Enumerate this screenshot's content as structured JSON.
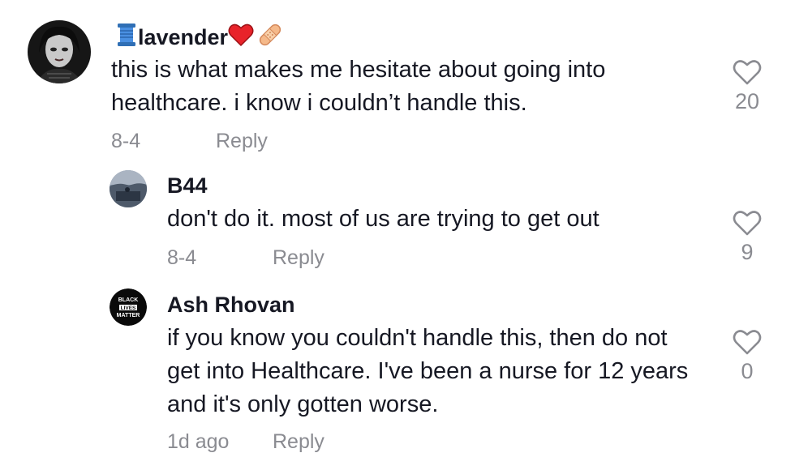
{
  "comments": [
    {
      "username": "lavender",
      "username_emojis": [
        "spool-icon",
        "heart-icon",
        "bandage-icon"
      ],
      "text": "this is what makes me hesitate about going into healthcare. i know i couldn’t handle this.",
      "date": "8-4",
      "reply_label": "Reply",
      "likes": "20"
    },
    {
      "username": "B44",
      "text": "don't do it. most of us are trying to get out",
      "date": "8-4",
      "reply_label": "Reply",
      "likes": "9"
    },
    {
      "username": "Ash Rhovan",
      "avatar_text": [
        "BLACK",
        "LIVES",
        "MATTER"
      ],
      "text": "if you know you couldn't handle this, then do not get into Healthcare. I've been a nurse for 12 years and it's only gotten worse.",
      "date": "1d ago",
      "reply_label": "Reply",
      "likes": "0"
    }
  ],
  "colors": {
    "text": "#161823",
    "muted": "#8a8b91",
    "heart": "#e8232a"
  }
}
